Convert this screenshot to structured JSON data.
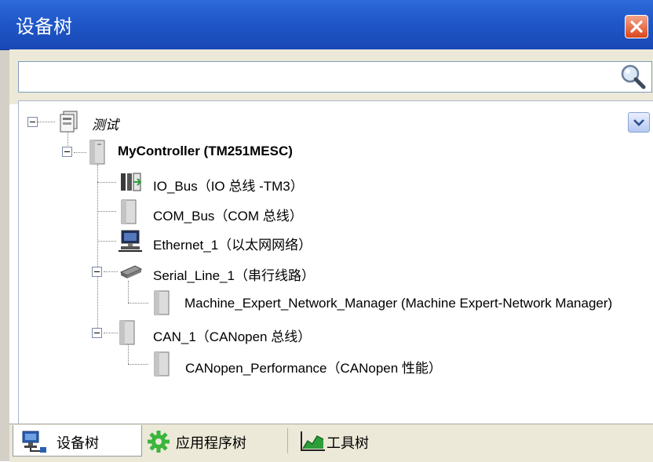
{
  "window": {
    "title": "设备树"
  },
  "search": {
    "value": "",
    "placeholder": ""
  },
  "tree": {
    "root": {
      "label": "测试"
    },
    "controller": {
      "label": "MyController (TM251MESC)"
    },
    "io_bus": {
      "label": "IO_Bus（IO 总线 -TM3）"
    },
    "com_bus": {
      "label": "COM_Bus（COM 总线）"
    },
    "ethernet": {
      "label": "Ethernet_1（以太网网络）"
    },
    "serial": {
      "label": "Serial_Line_1（串行线路）"
    },
    "network_manager": {
      "label": "Machine_Expert_Network_Manager (Machine Expert-Network Manager)"
    },
    "can": {
      "label": "CAN_1（CANopen 总线）"
    },
    "canopen_perf": {
      "label": "CANopen_Performance（CANopen 性能）"
    }
  },
  "tabs": [
    {
      "label": "设备树",
      "icon": "device-tree-icon",
      "active": true
    },
    {
      "label": "应用程序树",
      "icon": "gear-icon",
      "active": false
    },
    {
      "label": "工具树",
      "icon": "chart-tool-icon",
      "active": false
    }
  ],
  "colors": {
    "title_bar": "#1f57c9",
    "close_button": "#d9461c",
    "tab_bar": "#ece9d8"
  }
}
